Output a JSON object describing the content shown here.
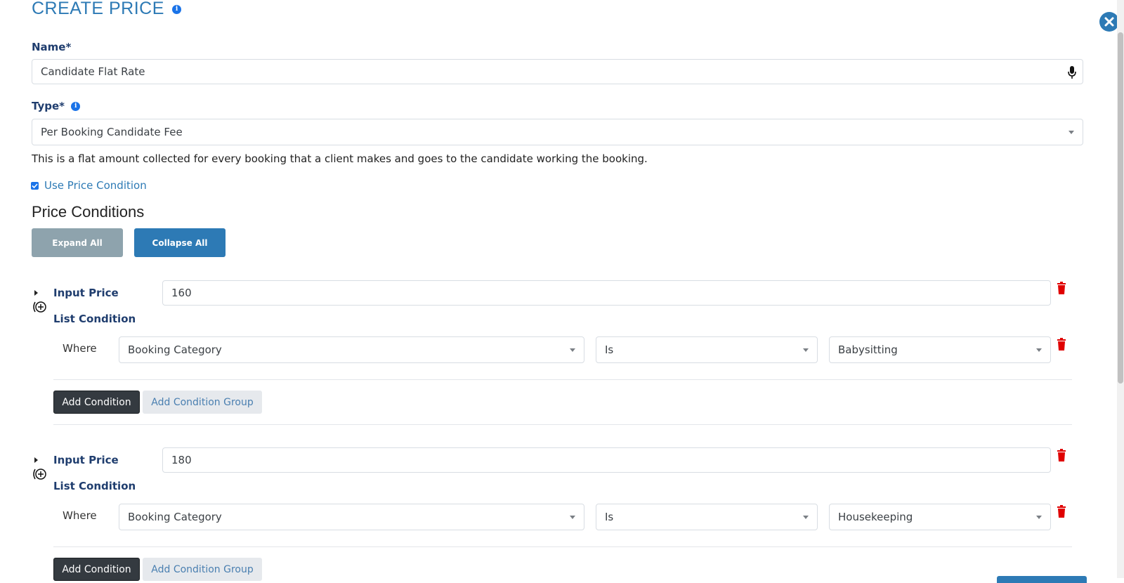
{
  "header": {
    "title": "CREATE PRICE"
  },
  "name_field": {
    "label": "Name*",
    "value": "Candidate Flat Rate"
  },
  "type_field": {
    "label": "Type*",
    "value": "Per Booking Candidate Fee"
  },
  "description": "This is a flat amount collected for every booking that a client makes and goes to the candidate working the booking.",
  "use_condition": {
    "label": "Use Price Condition",
    "checked": true
  },
  "conditions_section": {
    "title": "Price Conditions",
    "expand_label": "Expand All",
    "collapse_label": "Collapse All"
  },
  "conditions": [
    {
      "input_price_label": "Input Price",
      "price": "160",
      "list_label": "List Condition",
      "where_label": "Where",
      "field": "Booking Category",
      "operator": "Is",
      "value": "Babysitting",
      "add_condition": "Add Condition",
      "add_group": "Add Condition Group"
    },
    {
      "input_price_label": "Input Price",
      "price": "180",
      "list_label": "List Condition",
      "where_label": "Where",
      "field": "Booking Category",
      "operator": "Is",
      "value": "Housekeeping",
      "add_condition": "Add Condition",
      "add_group": "Add Condition Group"
    }
  ],
  "colors": {
    "accent": "#2d7ab5",
    "delete": "#e00000",
    "label": "#1f3d6e"
  }
}
